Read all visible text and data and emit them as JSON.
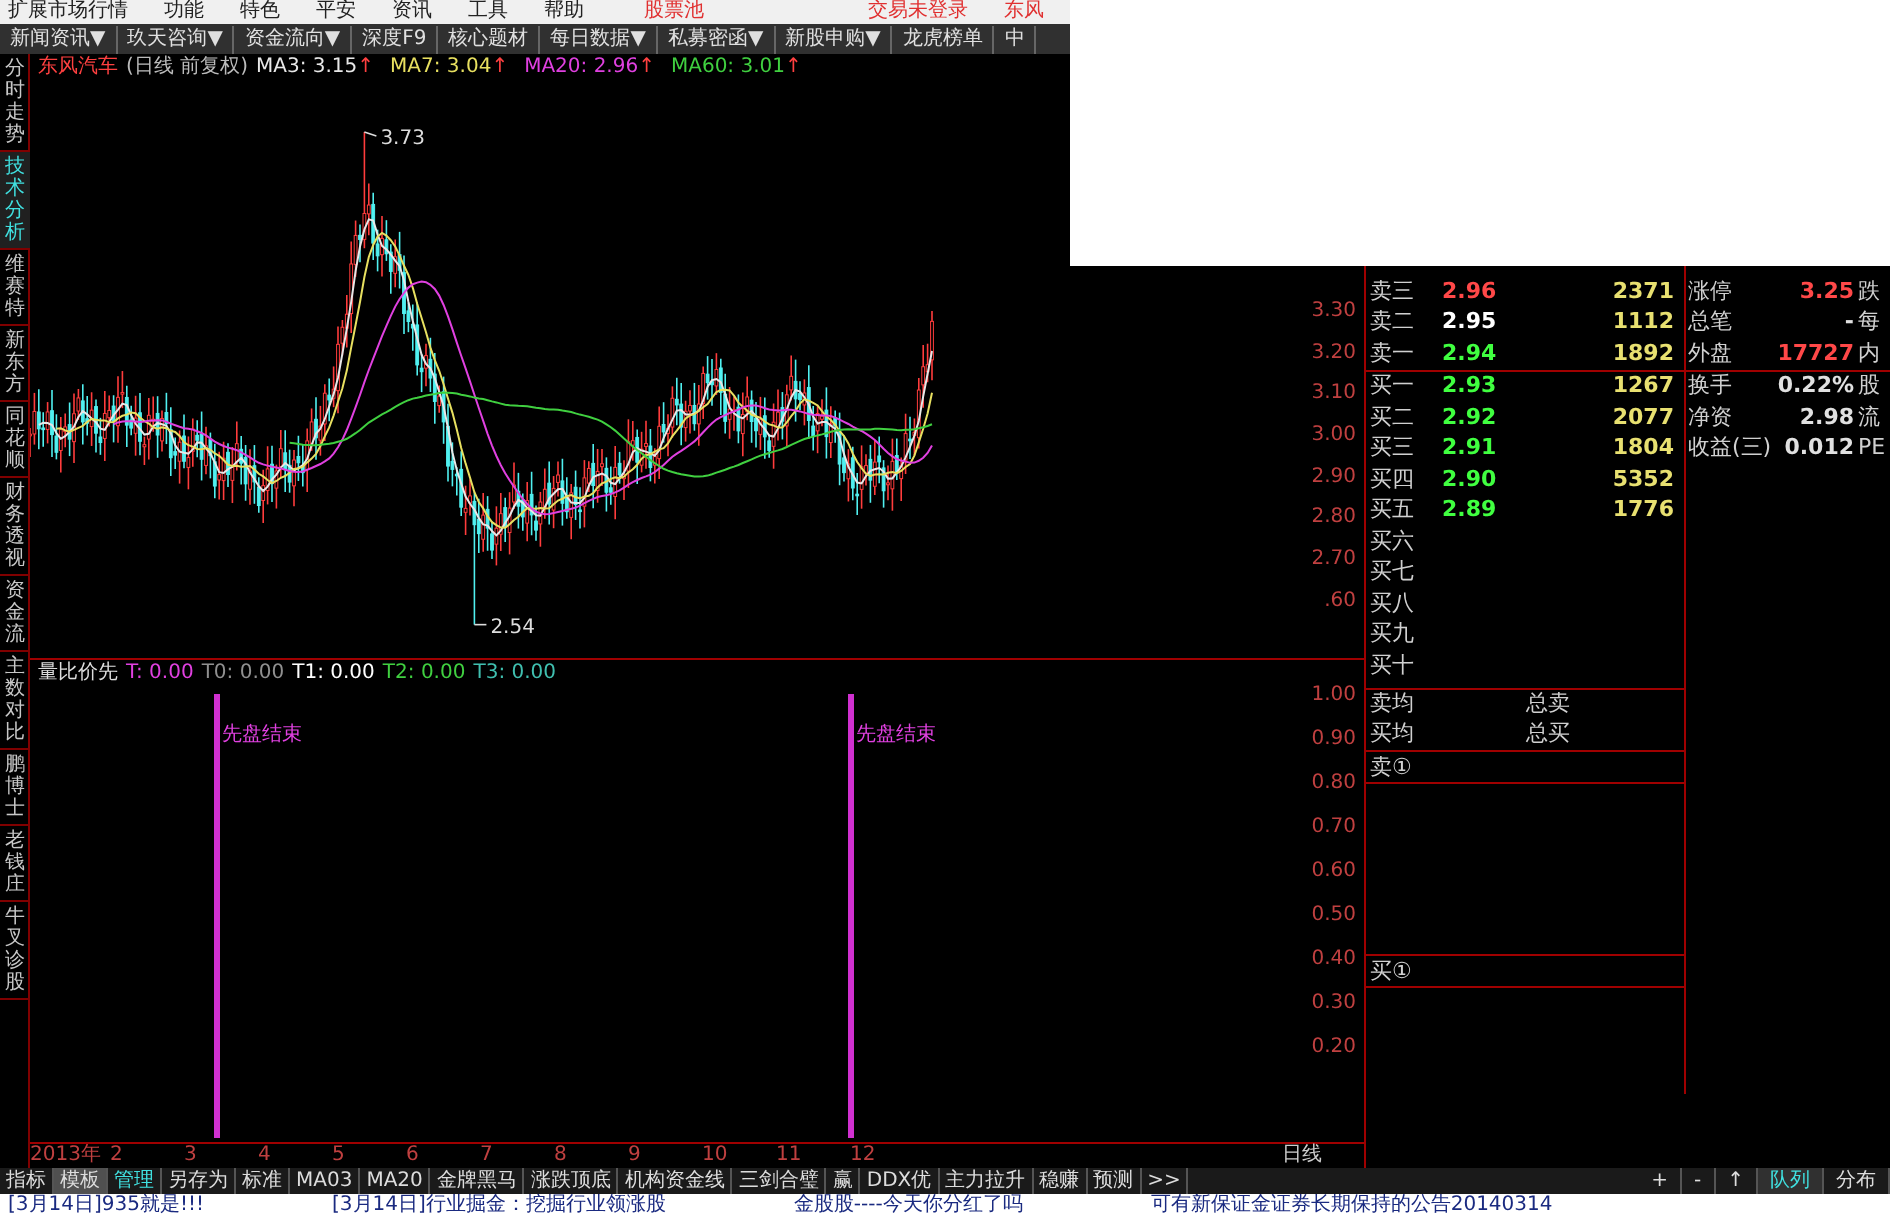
{
  "menu_bar": {
    "items": [
      "扩展市场行情",
      "功能",
      "特色",
      "平安",
      "资讯",
      "工具",
      "帮助"
    ],
    "stock_pool": "股票池",
    "trade_status": "交易未登录",
    "cut_text": "东风"
  },
  "toolbar": [
    {
      "label": "新闻资讯▼"
    },
    {
      "label": "玖天咨询▼"
    },
    {
      "label": "资金流向▼"
    },
    {
      "label": "深度F9"
    },
    {
      "label": "核心题材"
    },
    {
      "label": "每日数据▼"
    },
    {
      "label": "私募密函▼"
    },
    {
      "label": "新股申购▼"
    },
    {
      "label": "龙虎榜单"
    },
    {
      "label": "中"
    }
  ],
  "side_tabs": [
    {
      "label": "分时走势",
      "selected": false
    },
    {
      "label": "技术分析",
      "selected": true
    },
    {
      "label": "维赛特",
      "selected": false
    },
    {
      "label": "新东方",
      "selected": false
    },
    {
      "label": "同花顺",
      "selected": false
    },
    {
      "label": "财务透视",
      "selected": false
    },
    {
      "label": "资金流",
      "selected": false
    },
    {
      "label": "主数对比",
      "selected": false
    },
    {
      "label": "鹏博士",
      "selected": false
    },
    {
      "label": "老钱庄",
      "selected": false
    },
    {
      "label": "牛叉诊股",
      "selected": false
    }
  ],
  "chart_header": {
    "stock": "东风汽车",
    "period": "(日线 前复权)",
    "indicators": [
      {
        "label": "MA3: 3.15",
        "trend": "↑",
        "color": "#e8e8e8"
      },
      {
        "label": "MA7: 3.04",
        "trend": "↑",
        "color": "#e8e060"
      },
      {
        "label": "MA20: 2.96",
        "trend": "↑",
        "color": "#e040e0"
      },
      {
        "label": "MA60: 3.01",
        "trend": "↑",
        "color": "#40d040"
      }
    ]
  },
  "price_chart": {
    "high_label": "3.73",
    "low_label": "2.54"
  },
  "price_axis": [
    "3.30",
    "3.20",
    "3.10",
    "3.00",
    "2.90",
    "2.80",
    "2.70",
    ".60"
  ],
  "order_book": {
    "asks": [
      {
        "label": "卖三",
        "price": "2.96",
        "volume": "2371",
        "color": "#ff4848"
      },
      {
        "label": "卖二",
        "price": "2.95",
        "volume": "1112",
        "color": "#ffffff"
      },
      {
        "label": "卖一",
        "price": "2.94",
        "volume": "1892",
        "color": "#40ff40"
      }
    ],
    "bids": [
      {
        "label": "买一",
        "price": "2.93",
        "volume": "1267",
        "color": "#40ff40"
      },
      {
        "label": "买二",
        "price": "2.92",
        "volume": "2077",
        "color": "#40ff40"
      },
      {
        "label": "买三",
        "price": "2.91",
        "volume": "1804",
        "color": "#40ff40"
      },
      {
        "label": "买四",
        "price": "2.90",
        "volume": "5352",
        "color": "#40ff40"
      },
      {
        "label": "买五",
        "price": "2.89",
        "volume": "1776",
        "color": "#40ff40"
      },
      {
        "label": "买六"
      },
      {
        "label": "买七"
      },
      {
        "label": "买八"
      },
      {
        "label": "买九"
      },
      {
        "label": "买十"
      }
    ]
  },
  "quote_info": [
    {
      "label": "涨停",
      "value": "3.25",
      "color": "#ff4848",
      "next": "跌"
    },
    {
      "label": "总笔",
      "value": "-",
      "color": "#e0e0e0",
      "next": "每"
    },
    {
      "label": "外盘",
      "value": "17727",
      "color": "#ff4848",
      "next": "内"
    },
    {
      "label": "换手",
      "value": "0.22%",
      "color": "#e0e0e0",
      "next": "股"
    },
    {
      "label": "净资",
      "value": "2.98",
      "color": "#e0e0e0",
      "next": "流"
    },
    {
      "label": "收益(三)",
      "value": "0.012",
      "color": "#e0e0e0",
      "next": "PE"
    }
  ],
  "indicator_pane": {
    "title": "量比价先",
    "values": [
      {
        "label": "T: 0.00",
        "color": "#e040e0"
      },
      {
        "label": "T0: 0.00",
        "color": "#909090"
      },
      {
        "label": "T1: 0.00",
        "color": "#ffffff"
      },
      {
        "label": "T2: 0.00",
        "color": "#40d040"
      },
      {
        "label": "T3: 0.00",
        "color": "#40c0b0"
      }
    ],
    "markers": [
      "先盘结束",
      "先盘结束"
    ],
    "axis": [
      "1.00",
      "0.90",
      "0.80",
      "0.70",
      "0.60",
      "0.50",
      "0.40",
      "0.30",
      "0.20"
    ]
  },
  "order_summary": {
    "rows": [
      {
        "label": "卖均",
        "total": "总卖"
      },
      {
        "label": "买均",
        "total": "总买"
      }
    ],
    "sell_first": "卖①",
    "buy_first": "买①"
  },
  "date_axis": [
    "2013年",
    "2",
    "3",
    "4",
    "5",
    "6",
    "7",
    "8",
    "9",
    "10",
    "11",
    "12"
  ],
  "period_label": "日线",
  "bottom_tabs": [
    {
      "label": "指标",
      "selected": false,
      "accent": false
    },
    {
      "label": "模板",
      "selected": true,
      "accent": false
    },
    {
      "label": "管理",
      "selected": false,
      "accent": true
    },
    {
      "label": "另存为",
      "selected": false,
      "accent": false
    },
    {
      "label": "标准",
      "selected": false,
      "accent": false
    },
    {
      "label": "MA03",
      "selected": false,
      "accent": false
    },
    {
      "label": "MA20",
      "selected": false,
      "accent": false
    },
    {
      "label": "金牌黑马",
      "selected": false,
      "accent": false
    },
    {
      "label": "涨跌顶底",
      "selected": false,
      "accent": false
    },
    {
      "label": "机构资金线",
      "selected": false,
      "accent": false
    },
    {
      "label": "三剑合璧",
      "selected": false,
      "accent": false
    },
    {
      "label": "赢",
      "selected": false,
      "accent": false
    },
    {
      "label": "DDX优",
      "selected": false,
      "accent": false
    },
    {
      "label": "主力拉升",
      "selected": false,
      "accent": false
    },
    {
      "label": "稳赚",
      "selected": false,
      "accent": false
    },
    {
      "label": "预测",
      "selected": false,
      "accent": false
    },
    {
      "label": ">>",
      "selected": false,
      "accent": false
    }
  ],
  "panel_buttons": [
    {
      "label": "+",
      "selected": false
    },
    {
      "label": "-",
      "selected": false
    },
    {
      "label": "↑",
      "selected": false
    },
    {
      "label": "队列",
      "selected": true
    },
    {
      "label": "分布",
      "selected": false
    }
  ],
  "news_ticker": [
    "[3月14日]935就是!!!",
    "[3月14日]行业掘金：挖掘行业领涨股",
    "金股股----今天你分红了吗",
    "可有新保证金证券长期保持的公告20140314"
  ]
}
